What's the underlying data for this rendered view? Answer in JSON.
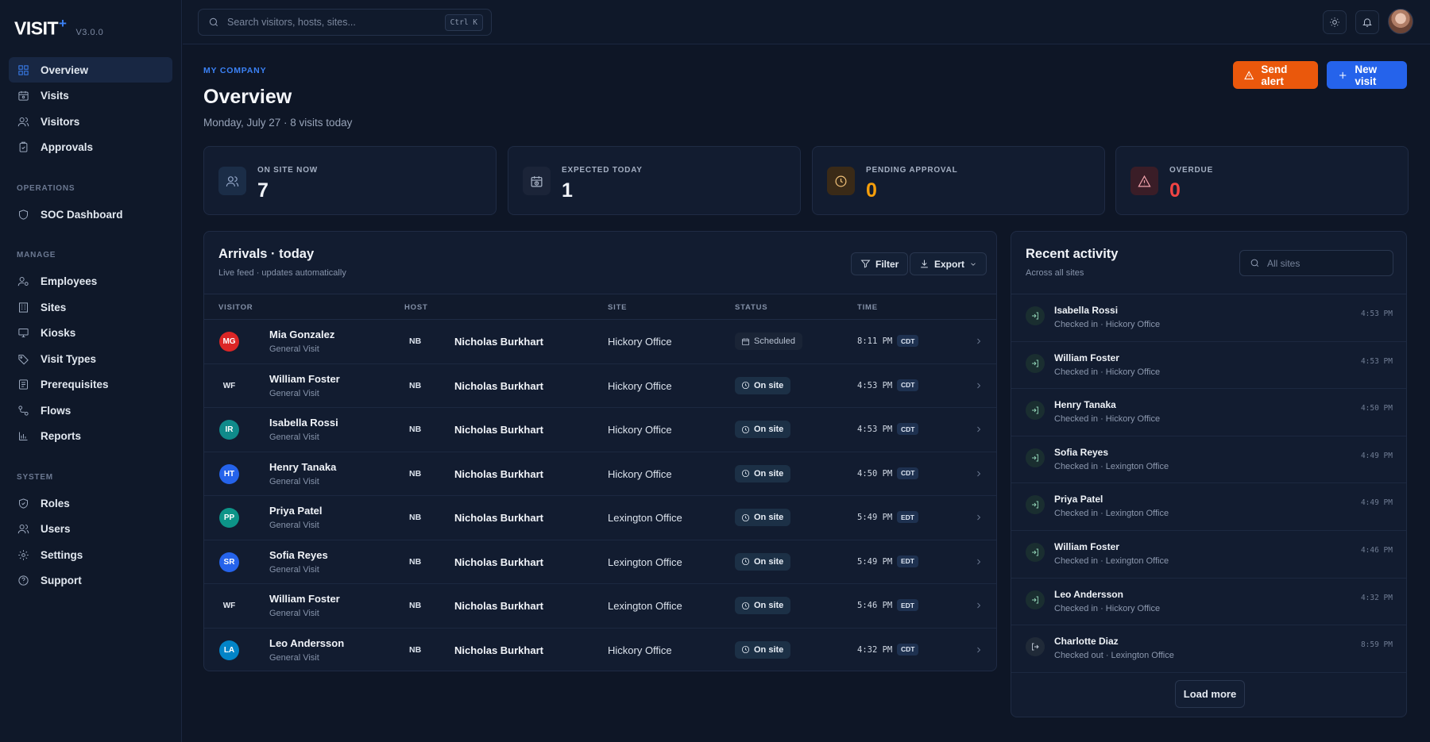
{
  "brand": {
    "name": "VISIT",
    "mark": "+",
    "version": "V3.0.0"
  },
  "search": {
    "placeholder": "Search visitors, hosts, sites...",
    "shortcut": "Ctrl K"
  },
  "sidebar": {
    "main": [
      {
        "label": "Overview",
        "icon": "grid-icon",
        "active": true
      },
      {
        "label": "Visits",
        "icon": "calendar-icon"
      },
      {
        "label": "Visitors",
        "icon": "users-icon"
      },
      {
        "label": "Approvals",
        "icon": "clipboard-check-icon"
      }
    ],
    "operations_label": "OPERATIONS",
    "operations": [
      {
        "label": "SOC Dashboard",
        "icon": "shield-icon"
      }
    ],
    "manage_label": "MANAGE",
    "manage": [
      {
        "label": "Employees",
        "icon": "user-cog-icon"
      },
      {
        "label": "Sites",
        "icon": "building-icon"
      },
      {
        "label": "Kiosks",
        "icon": "monitor-icon"
      },
      {
        "label": "Visit Types",
        "icon": "tag-icon"
      },
      {
        "label": "Prerequisites",
        "icon": "list-icon"
      },
      {
        "label": "Flows",
        "icon": "flow-icon"
      },
      {
        "label": "Reports",
        "icon": "bar-chart-icon"
      }
    ],
    "system_label": "SYSTEM",
    "system": [
      {
        "label": "Roles",
        "icon": "shield-check-icon"
      },
      {
        "label": "Users",
        "icon": "users-icon"
      },
      {
        "label": "Settings",
        "icon": "gear-icon"
      },
      {
        "label": "Support",
        "icon": "help-icon"
      }
    ]
  },
  "header": {
    "eyebrow": "MY COMPANY",
    "title": "Overview",
    "subtitle": "Monday, July 27 · 8 visits today",
    "send_alert": "Send alert",
    "new_visit": "New visit"
  },
  "stats": [
    {
      "label": "ON SITE NOW",
      "value": "7",
      "icon": "users-icon",
      "color": "#f1f4f9"
    },
    {
      "label": "EXPECTED TODAY",
      "value": "1",
      "icon": "calendar-clock-icon",
      "color": "#f1f4f9"
    },
    {
      "label": "PENDING APPROVAL",
      "value": "0",
      "icon": "clock-icon",
      "color": "#f59e0b"
    },
    {
      "label": "OVERDUE",
      "value": "0",
      "icon": "alert-triangle-icon",
      "color": "#ef4444"
    }
  ],
  "arrivals": {
    "title": "Arrivals · today",
    "subtitle": "Live feed · updates automatically",
    "filter": "Filter",
    "export": "Export",
    "columns": [
      "VISITOR",
      "HOST",
      "SITE",
      "STATUS",
      "TIME"
    ],
    "rows": [
      {
        "initials": "MG",
        "color": "#dc2626",
        "name": "Mia Gonzalez",
        "type": "General Visit",
        "host_initials": "NB",
        "host": "Nicholas Burkhart",
        "site": "Hickory Office",
        "status": "Scheduled",
        "time": "8:11 PM",
        "tz": "CDT"
      },
      {
        "initials": "WF",
        "color": "",
        "name": "William Foster",
        "type": "General Visit",
        "host_initials": "NB",
        "host": "Nicholas Burkhart",
        "site": "Hickory Office",
        "status": "On site",
        "time": "4:53 PM",
        "tz": "CDT"
      },
      {
        "initials": "IR",
        "color": "#0f8a8a",
        "name": "Isabella Rossi",
        "type": "General Visit",
        "host_initials": "NB",
        "host": "Nicholas Burkhart",
        "site": "Hickory Office",
        "status": "On site",
        "time": "4:53 PM",
        "tz": "CDT"
      },
      {
        "initials": "HT",
        "color": "#2563eb",
        "name": "Henry Tanaka",
        "type": "General Visit",
        "host_initials": "NB",
        "host": "Nicholas Burkhart",
        "site": "Hickory Office",
        "status": "On site",
        "time": "4:50 PM",
        "tz": "CDT"
      },
      {
        "initials": "PP",
        "color": "#0d9488",
        "name": "Priya Patel",
        "type": "General Visit",
        "host_initials": "NB",
        "host": "Nicholas Burkhart",
        "site": "Lexington Office",
        "status": "On site",
        "time": "5:49 PM",
        "tz": "EDT"
      },
      {
        "initials": "SR",
        "color": "#2563eb",
        "name": "Sofia Reyes",
        "type": "General Visit",
        "host_initials": "NB",
        "host": "Nicholas Burkhart",
        "site": "Lexington Office",
        "status": "On site",
        "time": "5:49 PM",
        "tz": "EDT"
      },
      {
        "initials": "WF",
        "color": "",
        "name": "William Foster",
        "type": "General Visit",
        "host_initials": "NB",
        "host": "Nicholas Burkhart",
        "site": "Lexington Office",
        "status": "On site",
        "time": "5:46 PM",
        "tz": "EDT"
      },
      {
        "initials": "LA",
        "color": "#0284c7",
        "name": "Leo Andersson",
        "type": "General Visit",
        "host_initials": "NB",
        "host": "Nicholas Burkhart",
        "site": "Hickory Office",
        "status": "On site",
        "time": "4:32 PM",
        "tz": "CDT"
      }
    ]
  },
  "activity": {
    "title": "Recent activity",
    "subtitle": "Across all sites",
    "search_placeholder": "All sites",
    "items": [
      {
        "name": "Isabella Rossi",
        "desc": "Checked in · Hickory Office",
        "time": "4:53 PM",
        "kind": "in"
      },
      {
        "name": "William Foster",
        "desc": "Checked in · Hickory Office",
        "time": "4:53 PM",
        "kind": "in"
      },
      {
        "name": "Henry Tanaka",
        "desc": "Checked in · Hickory Office",
        "time": "4:50 PM",
        "kind": "in"
      },
      {
        "name": "Sofia Reyes",
        "desc": "Checked in · Lexington Office",
        "time": "4:49 PM",
        "kind": "in"
      },
      {
        "name": "Priya Patel",
        "desc": "Checked in · Lexington Office",
        "time": "4:49 PM",
        "kind": "in"
      },
      {
        "name": "William Foster",
        "desc": "Checked in · Lexington Office",
        "time": "4:46 PM",
        "kind": "in"
      },
      {
        "name": "Leo Andersson",
        "desc": "Checked in · Hickory Office",
        "time": "4:32 PM",
        "kind": "in"
      },
      {
        "name": "Charlotte Diaz",
        "desc": "Checked out · Lexington Office",
        "time": "8:59 PM",
        "kind": "out"
      }
    ],
    "load_more": "Load more"
  }
}
